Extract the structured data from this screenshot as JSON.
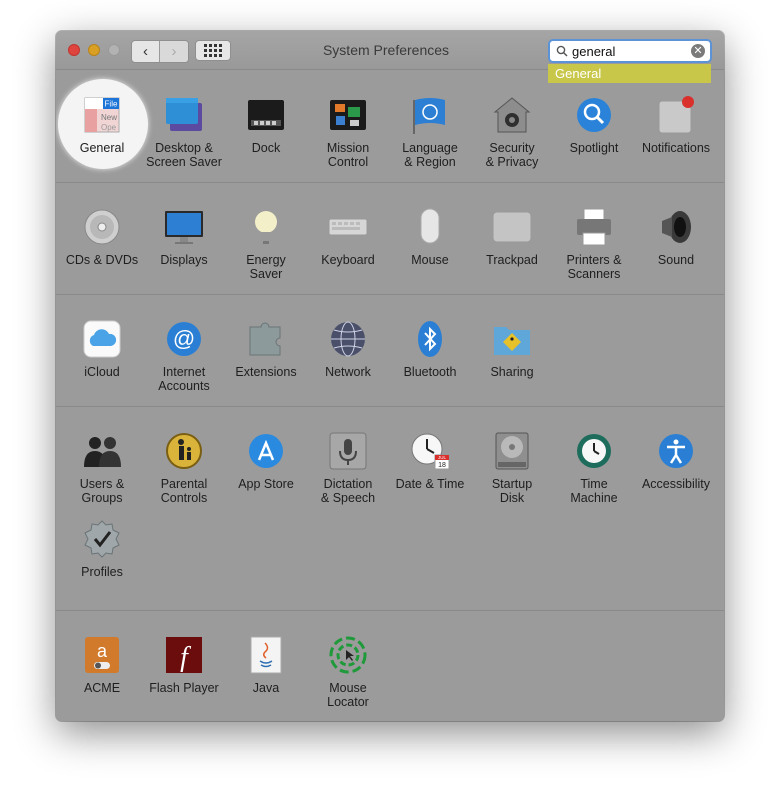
{
  "window": {
    "title": "System Preferences"
  },
  "search": {
    "value": "general",
    "suggestion": "General"
  },
  "nav": {
    "back": "‹",
    "forward": "›"
  },
  "sections": [
    [
      {
        "label": "General",
        "icon": "general-icon"
      },
      {
        "label": "Desktop &\nScreen Saver",
        "icon": "desktop-icon"
      },
      {
        "label": "Dock",
        "icon": "dock-icon"
      },
      {
        "label": "Mission\nControl",
        "icon": "mission-control-icon"
      },
      {
        "label": "Language\n& Region",
        "icon": "language-icon"
      },
      {
        "label": "Security\n& Privacy",
        "icon": "security-icon"
      },
      {
        "label": "Spotlight",
        "icon": "spotlight-icon"
      },
      {
        "label": "Notifications",
        "icon": "notifications-icon"
      }
    ],
    [
      {
        "label": "CDs & DVDs",
        "icon": "cd-icon"
      },
      {
        "label": "Displays",
        "icon": "display-icon"
      },
      {
        "label": "Energy\nSaver",
        "icon": "bulb-icon"
      },
      {
        "label": "Keyboard",
        "icon": "keyboard-icon"
      },
      {
        "label": "Mouse",
        "icon": "mouse-icon"
      },
      {
        "label": "Trackpad",
        "icon": "trackpad-icon"
      },
      {
        "label": "Printers &\nScanners",
        "icon": "printer-icon"
      },
      {
        "label": "Sound",
        "icon": "speaker-icon"
      }
    ],
    [
      {
        "label": "iCloud",
        "icon": "icloud-icon"
      },
      {
        "label": "Internet\nAccounts",
        "icon": "at-icon"
      },
      {
        "label": "Extensions",
        "icon": "puzzle-icon"
      },
      {
        "label": "Network",
        "icon": "globe-icon"
      },
      {
        "label": "Bluetooth",
        "icon": "bluetooth-icon"
      },
      {
        "label": "Sharing",
        "icon": "sharing-icon"
      }
    ],
    [
      {
        "label": "Users &\nGroups",
        "icon": "users-icon"
      },
      {
        "label": "Parental\nControls",
        "icon": "parental-icon"
      },
      {
        "label": "App Store",
        "icon": "appstore-icon"
      },
      {
        "label": "Dictation\n& Speech",
        "icon": "microphone-icon"
      },
      {
        "label": "Date & Time",
        "icon": "clock-icon"
      },
      {
        "label": "Startup\nDisk",
        "icon": "disk-icon"
      },
      {
        "label": "Time\nMachine",
        "icon": "timemachine-icon"
      },
      {
        "label": "Accessibility",
        "icon": "accessibility-icon"
      },
      {
        "label": "Profiles",
        "icon": "profiles-icon"
      }
    ],
    [
      {
        "label": "ACME",
        "icon": "acme-icon"
      },
      {
        "label": "Flash Player",
        "icon": "flash-icon"
      },
      {
        "label": "Java",
        "icon": "java-icon"
      },
      {
        "label": "Mouse\nLocator",
        "icon": "mouse-locator-icon"
      }
    ]
  ],
  "icon_text": {
    "general_file": "File",
    "general_new": "New",
    "general_ope": "Ope",
    "calendar_month": "JUL",
    "calendar_day": "18",
    "flash_glyph": "f",
    "acme_glyph": "a"
  },
  "colors": {
    "highlight": "#c8c74a",
    "search_ring": "#5c93d6",
    "window_bg": "#9b9b9b"
  }
}
